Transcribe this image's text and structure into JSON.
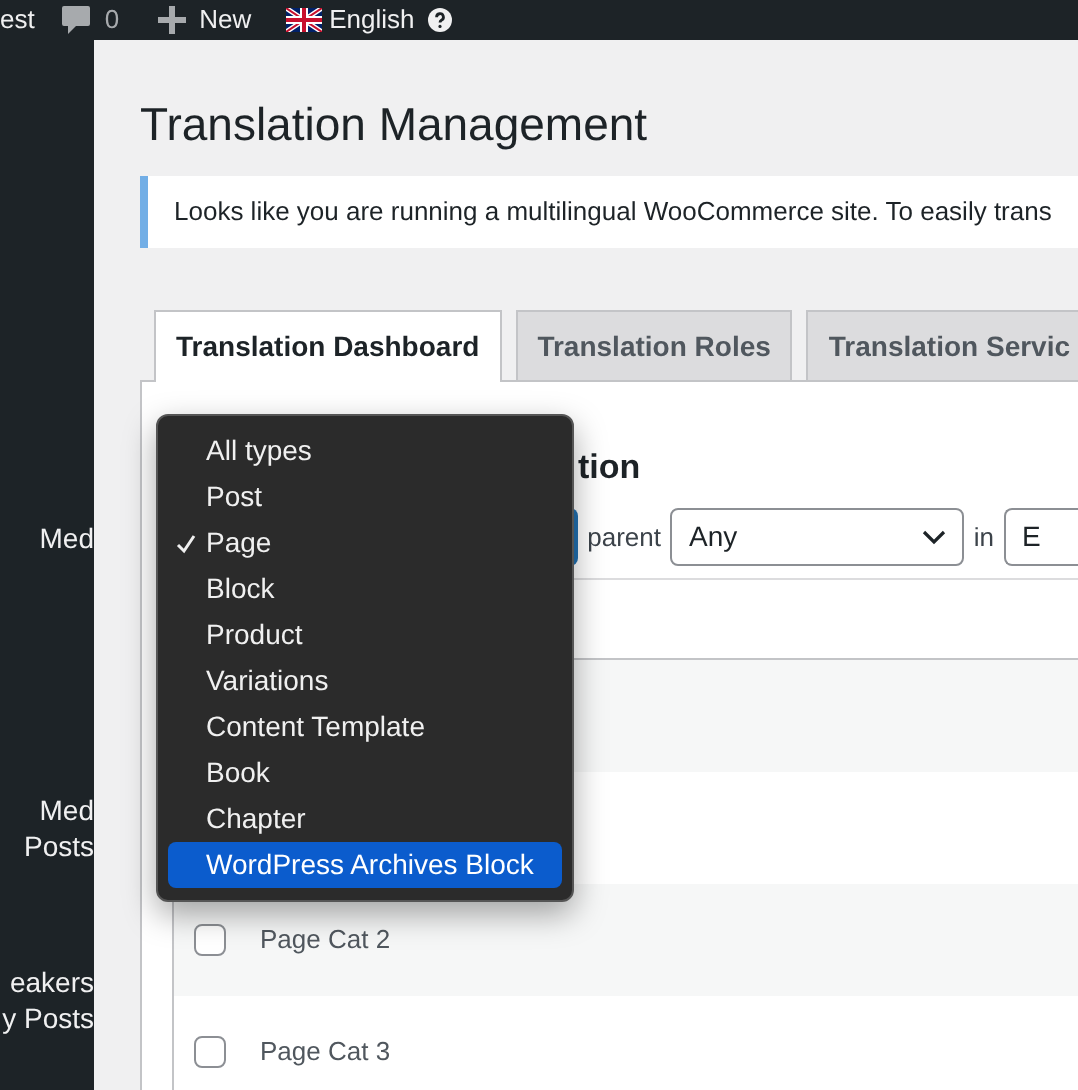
{
  "admin_bar": {
    "site_fragment": "est",
    "comments_count": "0",
    "new_label": "New",
    "language": "English"
  },
  "sidebar": {
    "items": [
      {
        "lines": [
          "Med"
        ]
      },
      {
        "lines": [
          "Med",
          "Posts"
        ]
      },
      {
        "lines": [
          "eakers",
          "y Posts"
        ]
      }
    ]
  },
  "page_title": "Translation Management",
  "notice": "Looks like you are running a multilingual WooCommerce site. To easily trans",
  "tabs": [
    {
      "label": "Translation Dashboard",
      "selected": true
    },
    {
      "label": "Translation Roles",
      "selected": false
    },
    {
      "label": "Translation Servic",
      "selected": false
    }
  ],
  "section_heading": "tion",
  "filters": {
    "parent_label": "parent",
    "parent_value": "Any",
    "in_label": "in",
    "in_value": "E"
  },
  "table": {
    "rows": [
      {
        "kind": "covered"
      },
      {
        "kind": "covered"
      },
      {
        "kind": "item",
        "title": "Page Cat 2",
        "checked": false
      },
      {
        "kind": "item",
        "title": "Page Cat 3",
        "checked": false
      }
    ]
  },
  "type_dropdown": {
    "options": [
      {
        "label": "All types",
        "checked": false,
        "highlighted": false
      },
      {
        "label": "Post",
        "checked": false,
        "highlighted": false
      },
      {
        "label": "Page",
        "checked": true,
        "highlighted": false
      },
      {
        "label": "Block",
        "checked": false,
        "highlighted": false
      },
      {
        "label": "Product",
        "checked": false,
        "highlighted": false
      },
      {
        "label": "Variations",
        "checked": false,
        "highlighted": false
      },
      {
        "label": "Content Template",
        "checked": false,
        "highlighted": false
      },
      {
        "label": "Book",
        "checked": false,
        "highlighted": false
      },
      {
        "label": "Chapter",
        "checked": false,
        "highlighted": false
      },
      {
        "label": "WordPress Archives Block",
        "checked": false,
        "highlighted": true
      }
    ]
  }
}
